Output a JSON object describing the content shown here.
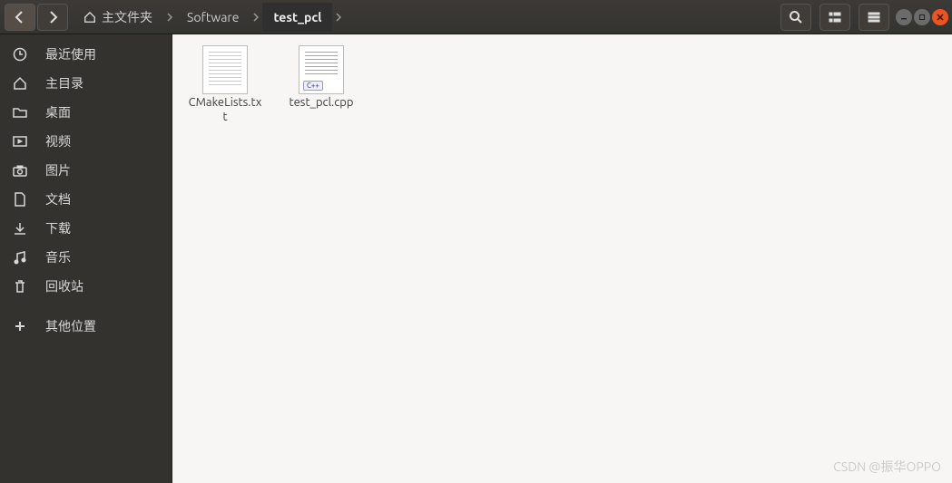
{
  "breadcrumb": {
    "home_label": "主文件夹",
    "segments": [
      "Software",
      "test_pcl"
    ]
  },
  "sidebar": {
    "items": [
      {
        "icon": "clock-icon",
        "label": "最近使用"
      },
      {
        "icon": "home-icon",
        "label": "主目录"
      },
      {
        "icon": "folder-icon",
        "label": "桌面"
      },
      {
        "icon": "video-icon",
        "label": "视频"
      },
      {
        "icon": "camera-icon",
        "label": "图片"
      },
      {
        "icon": "document-icon",
        "label": "文档"
      },
      {
        "icon": "download-icon",
        "label": "下载"
      },
      {
        "icon": "music-icon",
        "label": "音乐"
      },
      {
        "icon": "trash-icon",
        "label": "回收站"
      }
    ],
    "other_locations": {
      "icon": "plus-icon",
      "label": "其他位置"
    }
  },
  "files": [
    {
      "name": "CMakeLists.txt",
      "type": "text"
    },
    {
      "name": "test_pcl.cpp",
      "type": "cpp"
    }
  ],
  "watermark": "CSDN @振华OPPO"
}
